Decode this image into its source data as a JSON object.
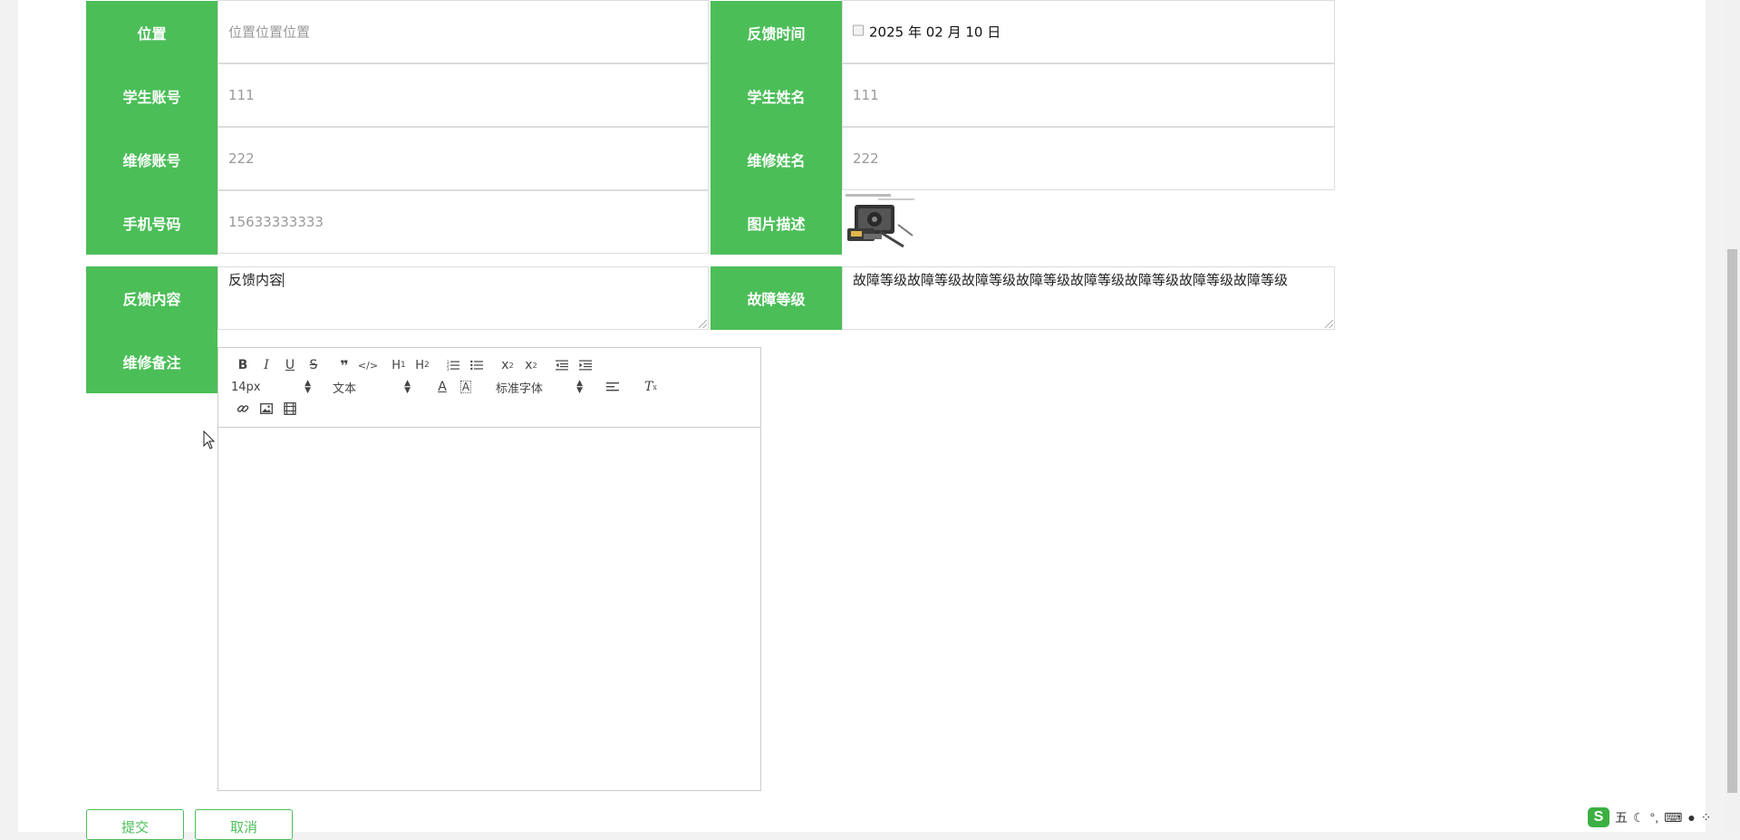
{
  "form": {
    "location": {
      "label": "位置",
      "placeholder": "位置位置位置"
    },
    "feedback_time": {
      "label": "反馈时间",
      "value": "2025 年 02 月 10 日"
    },
    "student_account": {
      "label": "学生账号",
      "value": "111"
    },
    "student_name": {
      "label": "学生姓名",
      "value": "111"
    },
    "repair_account": {
      "label": "维修账号",
      "value": "222"
    },
    "repair_name": {
      "label": "维修姓名",
      "value": "222"
    },
    "phone": {
      "label": "手机号码",
      "value": "15633333333"
    },
    "image_desc": {
      "label": "图片描述"
    },
    "feedback_content": {
      "label": "反馈内容",
      "value": "反馈内容"
    },
    "fault_level": {
      "label": "故障等级",
      "value": "故障等级故障等级故障等级故障等级故障等级故障等级故障等级故障等级"
    },
    "repair_note": {
      "label": "维修备注"
    }
  },
  "editor": {
    "font_size": "14px",
    "block_type": "文本",
    "font_family": "标准字体",
    "toolbar_row1": [
      "B",
      "I",
      "U",
      "S",
      "❞",
      "</>",
      "H1",
      "H2",
      "ordered-list",
      "bullet-list",
      "x₂",
      "x²",
      "outdent",
      "indent"
    ],
    "toolbar_row3": [
      "link",
      "image",
      "video"
    ]
  },
  "buttons": {
    "submit": "提交",
    "cancel": "取消"
  },
  "ime": {
    "mode": "五"
  },
  "colors": {
    "accent": "#4bbe58"
  }
}
